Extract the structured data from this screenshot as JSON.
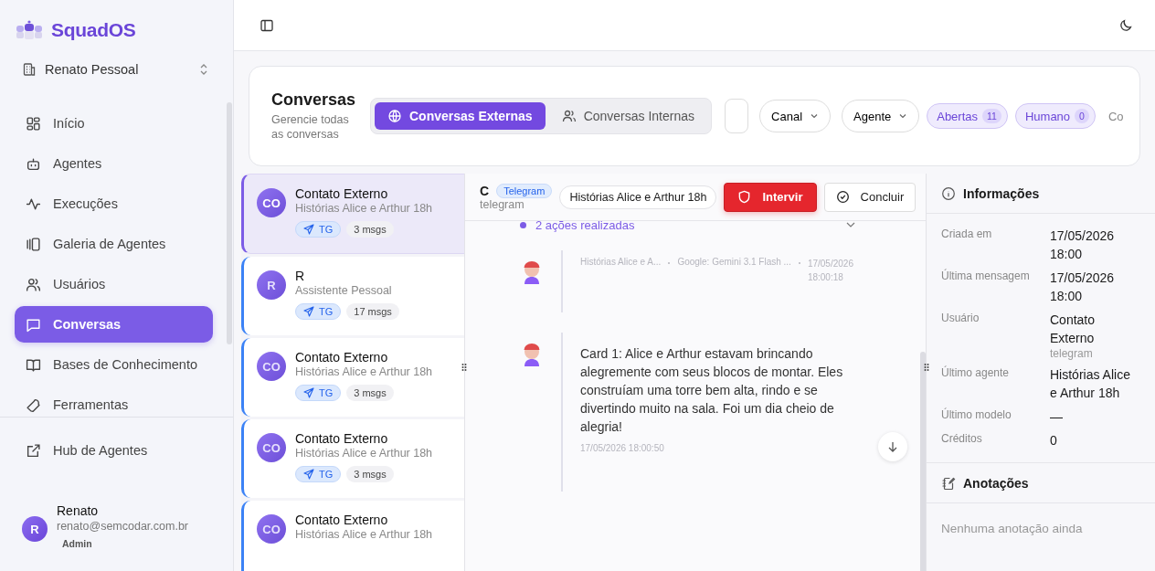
{
  "brand": {
    "name": "SquadOS"
  },
  "org": {
    "name": "Renato Pessoal"
  },
  "nav": [
    {
      "label": "Início",
      "selected": false
    },
    {
      "label": "Agentes",
      "selected": false
    },
    {
      "label": "Execuções",
      "selected": false
    },
    {
      "label": "Galeria de Agentes",
      "selected": false
    },
    {
      "label": "Usuários",
      "selected": false
    },
    {
      "label": "Conversas",
      "selected": true
    },
    {
      "label": "Bases de Conhecimento",
      "selected": false
    },
    {
      "label": "Ferramentas",
      "selected": false
    }
  ],
  "footer_nav": [
    {
      "label": "Hub de Agentes"
    }
  ],
  "user": {
    "initial": "R",
    "name": "Renato",
    "email": "renato@semcodar.com.br",
    "role": "Admin"
  },
  "header": {
    "title": "Conversas",
    "subtitle": "Gerencie todas as conversas",
    "tabs": [
      {
        "label": "Conversas Externas",
        "selected": true
      },
      {
        "label": "Conversas Internas",
        "selected": false
      }
    ],
    "filters": [
      {
        "label": "Canal"
      },
      {
        "label": "Agente"
      }
    ],
    "status_chips": [
      {
        "label": "Abertas",
        "count": "11"
      },
      {
        "label": "Humano",
        "count": "0"
      }
    ],
    "cut_label": "Co"
  },
  "conversations": [
    {
      "initials": "CO",
      "name": "Contato Externo",
      "agent": "Histórias Alice e Arthur 18h",
      "channel": "TG",
      "messages": "3 msgs",
      "selected": true
    },
    {
      "initials": "R",
      "name": "R",
      "agent": "Assistente Pessoal",
      "channel": "TG",
      "messages": "17 msgs",
      "selected": false
    },
    {
      "initials": "CO",
      "name": "Contato Externo",
      "agent": "Histórias Alice e Arthur 18h",
      "channel": "TG",
      "messages": "3 msgs",
      "selected": false
    },
    {
      "initials": "CO",
      "name": "Contato Externo",
      "agent": "Histórias Alice e Arthur 18h",
      "channel": "TG",
      "messages": "3 msgs",
      "selected": false
    },
    {
      "initials": "CO",
      "name": "Contato Externo",
      "agent": "Histórias Alice e Arthur 18h",
      "selected": false
    }
  ],
  "chat": {
    "title": "C",
    "channel_badge": "Telegram",
    "channel": "telegram",
    "agent": "Histórias Alice e Arthur 18h",
    "buttons": [
      {
        "label": "Intervir",
        "kind": "danger"
      },
      {
        "label": "Concluir",
        "kind": "outline"
      }
    ],
    "actions": "2 ações realizadas",
    "messages": [
      {
        "kind": "meta",
        "agent": "Histórias Alice e A...",
        "model": "Google: Gemini 3.1 Flash ...",
        "time": "17/05/2026 18:00:18"
      },
      {
        "kind": "text",
        "text": "Card 1: Alice e Arthur estavam brincando alegremente com seus blocos de montar. Eles construíam uma torre bem alta, rindo e se divertindo muito na sala. Foi um dia cheio de alegria!",
        "time": "17/05/2026 18:00:50"
      }
    ]
  },
  "info": {
    "title": "Informações",
    "rows": [
      {
        "label": "Criada em",
        "value": "17/05/2026 18:00"
      },
      {
        "label": "Última mensagem",
        "value": "17/05/2026 18:00"
      },
      {
        "label": "Usuário",
        "value": "Contato Externo",
        "sub": "telegram"
      },
      {
        "label": "Último agente",
        "value": "Histórias Alice e Arthur 18h"
      },
      {
        "label": "Último modelo",
        "value": "—"
      },
      {
        "label": "Créditos",
        "value": "0"
      }
    ],
    "notes_title": "Anotações",
    "notes_empty": "Nenhuma anotação ainda"
  }
}
